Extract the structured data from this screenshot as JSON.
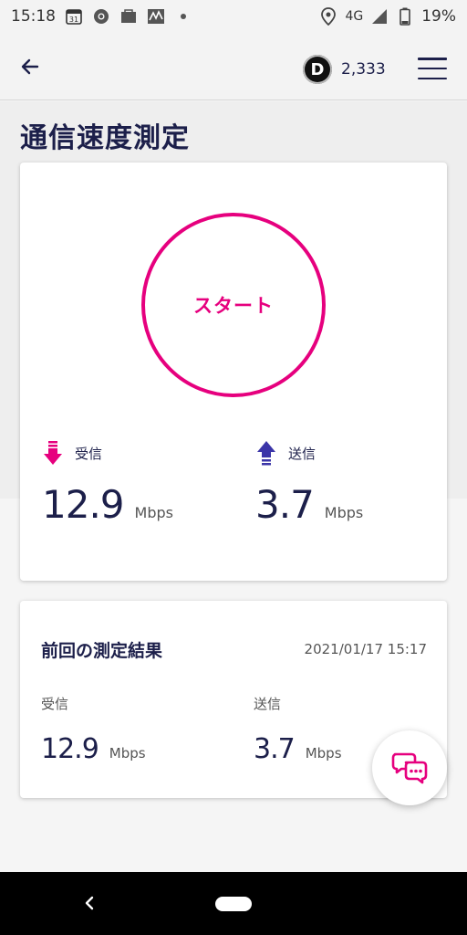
{
  "status_bar": {
    "time": "15:18",
    "calendar_day": "31",
    "network": "4G",
    "battery": "19%"
  },
  "header": {
    "points": "2,333",
    "points_badge": "D"
  },
  "page": {
    "title": "通信速度測定"
  },
  "speed_test": {
    "start_label": "スタート",
    "download": {
      "label": "受信",
      "value": "12.9",
      "unit": "Mbps"
    },
    "upload": {
      "label": "送信",
      "value": "3.7",
      "unit": "Mbps"
    }
  },
  "previous": {
    "title": "前回の測定結果",
    "date": "2021/01/17 15:17",
    "download": {
      "label": "受信",
      "value": "12.9",
      "unit": "Mbps"
    },
    "upload": {
      "label": "送信",
      "value": "3.7",
      "unit": "Mbps"
    }
  },
  "colors": {
    "accent": "#e6007e",
    "upload_arrow": "#3b35a8",
    "text": "#1c1f4a"
  },
  "icons": [
    "back-arrow-icon",
    "menu-icon",
    "download-arrow-icon",
    "upload-arrow-icon",
    "chat-icon"
  ]
}
